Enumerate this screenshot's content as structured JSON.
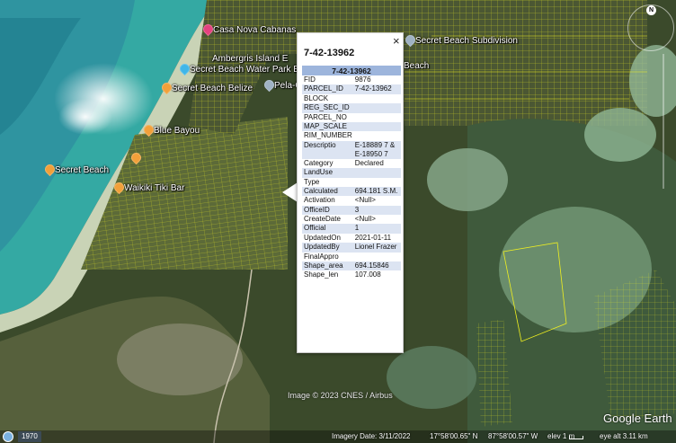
{
  "places": [
    {
      "id": "casa-nova",
      "label": "Casa Nova Cabanas",
      "style": "pink"
    },
    {
      "id": "ambergris",
      "label": "Ambergris Island E",
      "style": "none"
    },
    {
      "id": "secret-water-park",
      "label": "Secret Beach Water Park Bar & G",
      "style": "blue"
    },
    {
      "id": "pelicans",
      "label": "Pela-C",
      "style": "gray"
    },
    {
      "id": "secret-beach-belize",
      "label": "Secret Beach Belize",
      "style": "orange"
    },
    {
      "id": "blue-bayou",
      "label": "Blue Bayou",
      "style": "orange"
    },
    {
      "id": "secret-beach",
      "label": "Secret Beach",
      "style": "orange"
    },
    {
      "id": "waikiki",
      "label": "Waikiki Tiki Bar",
      "style": "orange"
    },
    {
      "id": "subdivision",
      "label": "Secret Beach Subdivision",
      "style": "gray"
    },
    {
      "id": "beach-label",
      "label": "Beach",
      "style": "none"
    },
    {
      "id": "unlabeled-1",
      "label": "",
      "style": "orange"
    }
  ],
  "balloon": {
    "title": "7-42-13962",
    "close_label": "×",
    "table_header": "7-42-13962",
    "rows": [
      {
        "key": "FID",
        "value": "9876"
      },
      {
        "key": "PARCEL_ID",
        "value": "7-42-13962"
      },
      {
        "key": "BLOCK",
        "value": ""
      },
      {
        "key": "REG_SEC_ID",
        "value": ""
      },
      {
        "key": "PARCEL_NO",
        "value": ""
      },
      {
        "key": "MAP_SCALE",
        "value": ""
      },
      {
        "key": "RIM_NUMBER",
        "value": ""
      },
      {
        "key": "Descriptio",
        "value": "E-18889 7 & E-18950 7"
      },
      {
        "key": "Category",
        "value": "Declared"
      },
      {
        "key": "LandUse",
        "value": ""
      },
      {
        "key": "Type",
        "value": ""
      },
      {
        "key": "Calculated",
        "value": "694.181 S.M."
      },
      {
        "key": "Activation",
        "value": "<Null>"
      },
      {
        "key": "OfficeID",
        "value": "3"
      },
      {
        "key": "CreateDate",
        "value": "<Null>"
      },
      {
        "key": "Official",
        "value": "1"
      },
      {
        "key": "UpdatedOn",
        "value": "2021-01-11"
      },
      {
        "key": "UpdatedBy",
        "value": "Lionel Frazer"
      },
      {
        "key": "FinalAppro",
        "value": ""
      },
      {
        "key": "Shape_area",
        "value": "694.15846"
      },
      {
        "key": "Shape_len",
        "value": "107.008"
      }
    ]
  },
  "copyright": "Image © 2023 CNES / Airbus",
  "logo": "Google Earth",
  "compass_label": "N",
  "status": {
    "year": "1970",
    "imagery_date": "Imagery Date: 3/11/2022",
    "lat": "17°58'00.65\" N",
    "lon": "87°58'00.57\" W",
    "elev": "elev   1 m",
    "eye_alt": "eye alt  3.11 km"
  },
  "colors": {
    "sea": "#3aa9a0",
    "deep_sea": "#1f7f8c",
    "land": "#4a5a2e",
    "parcel_lines": "#ffff00",
    "table_header": "#9db5dc",
    "table_alt_row": "#dce4f2"
  }
}
